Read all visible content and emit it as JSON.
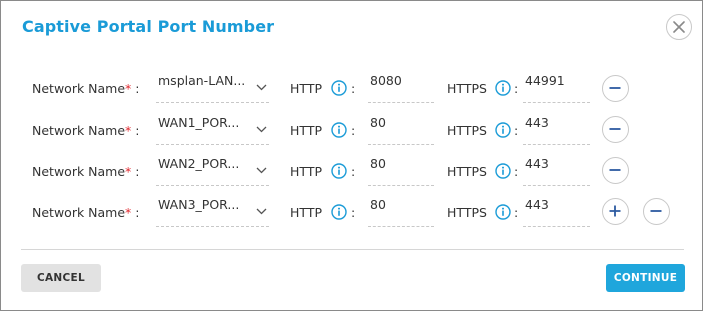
{
  "dialog": {
    "title": "Captive Portal Port Number",
    "close_icon": "close-icon"
  },
  "labels": {
    "network_name": "Network Name",
    "required_mark": "*",
    "separator": ":",
    "http": "HTTP",
    "https": "HTTPS",
    "info_icon": "info-icon"
  },
  "rows": [
    {
      "network": "msplan-LAN...",
      "http_port": "8080",
      "https_port": "44991"
    },
    {
      "network": "WAN1_POR...",
      "http_port": "80",
      "https_port": "443"
    },
    {
      "network": "WAN2_POR...",
      "http_port": "80",
      "https_port": "443"
    },
    {
      "network": "WAN3_POR...",
      "http_port": "80",
      "https_port": "443"
    }
  ],
  "footer": {
    "cancel_label": "CANCEL",
    "continue_label": "CONTINUE"
  },
  "colors": {
    "accent": "#1a9bd7",
    "button_primary": "#1fa6dc",
    "button_secondary": "#e2e2e2",
    "required": "#e0282e",
    "icon_blue": "#1a9bd7",
    "icon_dark": "#2c5aa0"
  }
}
